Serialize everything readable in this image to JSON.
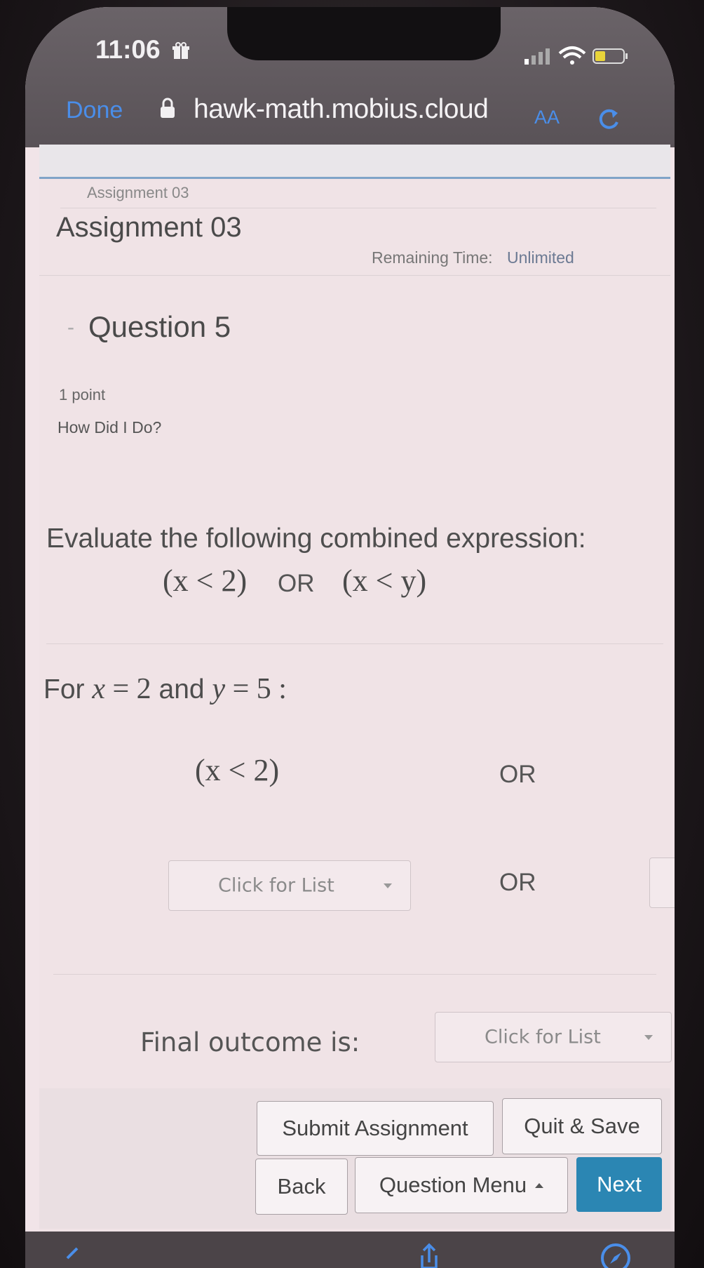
{
  "status_bar": {
    "time": "11:06"
  },
  "browser": {
    "done_label": "Done",
    "url": "hawk-math.mobius.cloud",
    "text_size_label": "AA"
  },
  "page": {
    "breadcrumb": "Assignment 03",
    "title": "Assignment 03",
    "remaining_label": "Remaining Time:",
    "remaining_value": "Unlimited"
  },
  "question": {
    "title": "Question 5",
    "points": "1 point",
    "how_did_i_do": "How Did I Do?",
    "prompt": "Evaluate the following combined expression:",
    "expr_left": "(x < 2)",
    "expr_op": "OR",
    "expr_right": "(x < y)",
    "given_prefix": "For",
    "given_x_var": "x",
    "given_x_val": "= 2",
    "given_and": "and",
    "given_y_var": "y",
    "given_y_val": "= 5 :",
    "row1_left": "(x < 2)",
    "row1_op": "OR",
    "row2_dropdown": "Click for List",
    "row2_op": "OR",
    "final_label": "Final outcome is:",
    "final_dropdown": "Click for List"
  },
  "footer": {
    "submit": "Submit Assignment",
    "quit_save": "Quit & Save",
    "back": "Back",
    "question_menu": "Question Menu",
    "next": "Next"
  },
  "icons": {
    "clock_icon": "gift-icon",
    "reload": "reload-icon",
    "lock": "lock-icon",
    "share": "share-icon",
    "compass": "compass-icon"
  },
  "colors": {
    "link_blue": "#4a8ee9",
    "next_button": "#2b86b3"
  }
}
